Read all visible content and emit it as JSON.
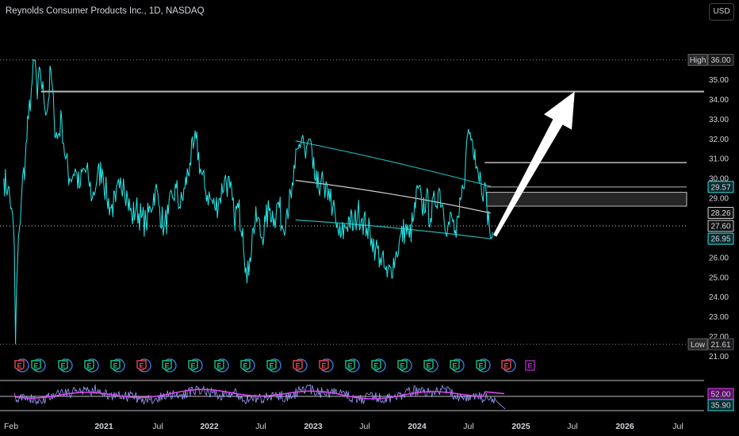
{
  "header": {
    "title": "Reynolds Consumer Products Inc., 1D, NASDAQ",
    "currency_button": "USD"
  },
  "colors": {
    "price_line": "#26e6e6",
    "band": "#26c6c6",
    "midline": "#e8e8e8",
    "arrow": "#ffffff",
    "rsi": "#9aa0ff",
    "rsi_ma": "#d946ef",
    "earnings_red": "#e5484d",
    "earnings_green": "#19c37d",
    "earnings_blue": "#3b82f6",
    "earnings_purple": "#c026d3"
  },
  "price_axis": {
    "ticks": [
      "35.00",
      "34.00",
      "33.00",
      "32.00",
      "31.00",
      "30.00",
      "29.00",
      "27.00",
      "26.00",
      "25.00",
      "24.00",
      "23.00",
      "22.00",
      "21.00"
    ]
  },
  "price_badges": [
    {
      "label": "36.00",
      "value": 36.0,
      "tag": "High",
      "style": "hl"
    },
    {
      "label": "29.57",
      "value": 29.57,
      "style": "cyan"
    },
    {
      "label": "28.26",
      "value": 28.26,
      "style": "white"
    },
    {
      "label": "27.60",
      "value": 27.6,
      "style": "white"
    },
    {
      "label": "26.95",
      "value": 26.95,
      "style": "cyan"
    },
    {
      "label": "21.61",
      "value": 21.61,
      "tag": "Low",
      "style": "hl"
    }
  ],
  "time_axis": {
    "labels": [
      "Feb",
      "2021",
      "Jul",
      "2022",
      "Jul",
      "2023",
      "Jul",
      "2024",
      "Jul",
      "2025",
      "Jul",
      "2026",
      "Jul"
    ],
    "bold": [
      "2021",
      "2022",
      "2023",
      "2024",
      "2025",
      "2026"
    ]
  },
  "earnings_markers": [
    {
      "type": "red",
      "label": "E"
    },
    {
      "type": "green",
      "label": "E"
    },
    {
      "type": "green",
      "label": "E"
    },
    {
      "type": "green",
      "label": "E"
    },
    {
      "type": "green",
      "label": "E"
    },
    {
      "type": "red",
      "label": "E"
    },
    {
      "type": "green",
      "label": "E"
    },
    {
      "type": "green",
      "label": "E"
    },
    {
      "type": "green",
      "label": "E"
    },
    {
      "type": "green",
      "label": "E"
    },
    {
      "type": "green",
      "label": "E"
    },
    {
      "type": "red",
      "label": "E"
    },
    {
      "type": "red",
      "label": "E"
    },
    {
      "type": "green",
      "label": "E"
    },
    {
      "type": "green",
      "label": "E"
    },
    {
      "type": "green",
      "label": "E"
    },
    {
      "type": "green",
      "label": "E"
    },
    {
      "type": "green",
      "label": "E"
    },
    {
      "type": "green",
      "label": "E"
    },
    {
      "type": "red",
      "label": "E"
    },
    {
      "type": "future",
      "label": "E"
    }
  ],
  "rsi_panel": {
    "badges": [
      {
        "label": "52.00",
        "style": "magenta"
      },
      {
        "label": "35.90",
        "style": "cyan"
      }
    ]
  },
  "chart_data": {
    "type": "line",
    "title": "Reynolds Consumer Products Inc., 1D, NASDAQ",
    "series": [
      {
        "values": [
          [
            "2020-02-03",
            30.0
          ],
          [
            "2020-02-18",
            29.5
          ],
          [
            "2020-03-02",
            28.5
          ],
          [
            "2020-03-12",
            26.5
          ],
          [
            "2020-03-16",
            21.61
          ],
          [
            "2020-03-20",
            24.5
          ],
          [
            "2020-03-30",
            27.5
          ],
          [
            "2020-04-08",
            29.5
          ],
          [
            "2020-04-20",
            31.0
          ],
          [
            "2020-05-01",
            33.0
          ],
          [
            "2020-05-15",
            35.0
          ],
          [
            "2020-05-25",
            36.0
          ],
          [
            "2020-06-02",
            34.0
          ],
          [
            "2020-06-12",
            35.5
          ],
          [
            "2020-06-25",
            34.0
          ],
          [
            "2020-07-08",
            33.5
          ],
          [
            "2020-07-20",
            35.5
          ],
          [
            "2020-08-01",
            33.0
          ],
          [
            "2020-08-12",
            32.0
          ],
          [
            "2020-08-28",
            33.0
          ],
          [
            "2020-09-10",
            31.0
          ],
          [
            "2020-09-25",
            30.0
          ],
          [
            "2020-10-15",
            30.5
          ],
          [
            "2020-10-30",
            29.5
          ],
          [
            "2020-11-15",
            30.5
          ],
          [
            "2020-12-01",
            30.0
          ],
          [
            "2020-12-15",
            29.0
          ],
          [
            "2021-01-01",
            30.0
          ],
          [
            "2021-01-20",
            30.5
          ],
          [
            "2021-02-05",
            29.0
          ],
          [
            "2021-02-20",
            28.5
          ],
          [
            "2021-03-08",
            28.8
          ],
          [
            "2021-03-22",
            29.5
          ],
          [
            "2021-04-05",
            30.0
          ],
          [
            "2021-04-20",
            29.0
          ],
          [
            "2021-05-05",
            28.0
          ],
          [
            "2021-05-20",
            28.5
          ],
          [
            "2021-06-08",
            28.0
          ],
          [
            "2021-06-25",
            27.7
          ],
          [
            "2021-07-10",
            28.5
          ],
          [
            "2021-07-28",
            29.5
          ],
          [
            "2021-08-12",
            28.5
          ],
          [
            "2021-08-28",
            27.5
          ],
          [
            "2021-09-12",
            28.2
          ],
          [
            "2021-09-28",
            29.0
          ],
          [
            "2021-10-10",
            29.5
          ],
          [
            "2021-10-25",
            28.5
          ],
          [
            "2021-11-10",
            29.5
          ],
          [
            "2021-11-28",
            30.8
          ],
          [
            "2021-12-10",
            31.5
          ],
          [
            "2021-12-20",
            32.0
          ],
          [
            "2022-01-05",
            30.5
          ],
          [
            "2022-01-20",
            29.5
          ],
          [
            "2022-02-08",
            29.0
          ],
          [
            "2022-02-25",
            28.5
          ],
          [
            "2022-03-15",
            29.0
          ],
          [
            "2022-04-01",
            30.0
          ],
          [
            "2022-04-20",
            29.5
          ],
          [
            "2022-05-05",
            28.0
          ],
          [
            "2022-05-20",
            28.5
          ],
          [
            "2022-06-05",
            27.5
          ],
          [
            "2022-06-16",
            25.5
          ],
          [
            "2022-06-20",
            24.7
          ],
          [
            "2022-06-30",
            26.0
          ],
          [
            "2022-07-12",
            27.5
          ],
          [
            "2022-07-28",
            28.0
          ],
          [
            "2022-08-10",
            27.0
          ],
          [
            "2022-08-25",
            27.8
          ],
          [
            "2022-09-10",
            28.5
          ],
          [
            "2022-09-25",
            28.0
          ],
          [
            "2022-10-10",
            28.8
          ],
          [
            "2022-10-25",
            27.5
          ],
          [
            "2022-11-10",
            28.5
          ],
          [
            "2022-11-25",
            29.0
          ],
          [
            "2022-12-08",
            30.5
          ],
          [
            "2022-12-20",
            31.5
          ],
          [
            "2023-01-05",
            32.2
          ],
          [
            "2023-01-15",
            31.0
          ],
          [
            "2023-01-28",
            32.0
          ],
          [
            "2023-02-10",
            30.5
          ],
          [
            "2023-02-25",
            29.5
          ],
          [
            "2023-03-12",
            30.0
          ],
          [
            "2023-03-25",
            29.0
          ],
          [
            "2023-04-08",
            29.5
          ],
          [
            "2023-04-22",
            28.5
          ],
          [
            "2023-05-05",
            27.5
          ],
          [
            "2023-05-20",
            27.0
          ],
          [
            "2023-06-05",
            27.5
          ],
          [
            "2023-06-20",
            28.0
          ],
          [
            "2023-07-05",
            27.5
          ],
          [
            "2023-07-20",
            28.3
          ],
          [
            "2023-08-05",
            28.0
          ],
          [
            "2023-08-22",
            27.5
          ],
          [
            "2023-09-08",
            27.0
          ],
          [
            "2023-09-22",
            26.5
          ],
          [
            "2023-10-08",
            26.0
          ],
          [
            "2023-10-22",
            25.5
          ],
          [
            "2023-11-02",
            25.0
          ],
          [
            "2023-11-15",
            25.5
          ],
          [
            "2023-12-01",
            26.0
          ],
          [
            "2023-12-15",
            26.8
          ],
          [
            "2024-01-05",
            27.5
          ],
          [
            "2024-01-20",
            27.0
          ],
          [
            "2024-02-05",
            28.0
          ],
          [
            "2024-02-20",
            29.5
          ],
          [
            "2024-03-05",
            28.5
          ],
          [
            "2024-03-20",
            29.0
          ],
          [
            "2024-04-05",
            28.0
          ],
          [
            "2024-04-20",
            28.8
          ],
          [
            "2024-05-05",
            29.5
          ],
          [
            "2024-05-20",
            28.5
          ],
          [
            "2024-06-05",
            27.5
          ],
          [
            "2024-06-20",
            28.0
          ],
          [
            "2024-07-05",
            27.0
          ],
          [
            "2024-07-15",
            28.0
          ],
          [
            "2024-07-30",
            29.5
          ],
          [
            "2024-08-08",
            31.0
          ],
          [
            "2024-08-18",
            32.5
          ],
          [
            "2024-08-30",
            32.0
          ],
          [
            "2024-09-10",
            31.5
          ],
          [
            "2024-09-20",
            30.5
          ],
          [
            "2024-10-01",
            30.0
          ],
          [
            "2024-10-12",
            29.5
          ],
          [
            "2024-10-22",
            28.8
          ],
          [
            "2024-11-01",
            27.5
          ],
          [
            "2024-11-08",
            27.0
          ],
          [
            "2024-11-12",
            27.3
          ]
        ]
      }
    ],
    "levels": [
      34.4,
      30.8,
      29.57,
      29.3,
      28.6,
      27.6
    ],
    "projection_arrow": {
      "from": [
        "2024-11-20",
        27.1
      ],
      "to": [
        "2025-09-01",
        34.4
      ]
    },
    "x_range": [
      "2020-02-01",
      "2026-09-30"
    ],
    "ylim": [
      20.6,
      36.5
    ],
    "y_axis_ticks": [
      35,
      34,
      33,
      32,
      31,
      30,
      29,
      27,
      26,
      25,
      24,
      23,
      22,
      21
    ],
    "grid": false
  }
}
